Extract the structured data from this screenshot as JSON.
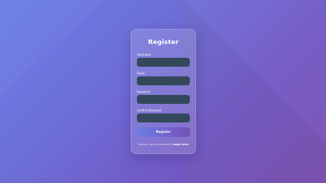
{
  "form": {
    "title": "Register",
    "fields": [
      {
        "label": "Username",
        "value": "",
        "placeholder": ""
      },
      {
        "label": "Email",
        "value": "",
        "placeholder": ""
      },
      {
        "label": "Password",
        "value": "",
        "placeholder": ""
      },
      {
        "label": "Confirm Password",
        "value": "",
        "placeholder": ""
      }
    ],
    "submit_label": "Register",
    "footer_text": "Already have an account?",
    "login_link": "Login here"
  },
  "colors": {
    "background_start": "#6a7fe6",
    "background_end": "#7a4fb0",
    "input_fill": "#33485a",
    "text": "#ffffff"
  }
}
